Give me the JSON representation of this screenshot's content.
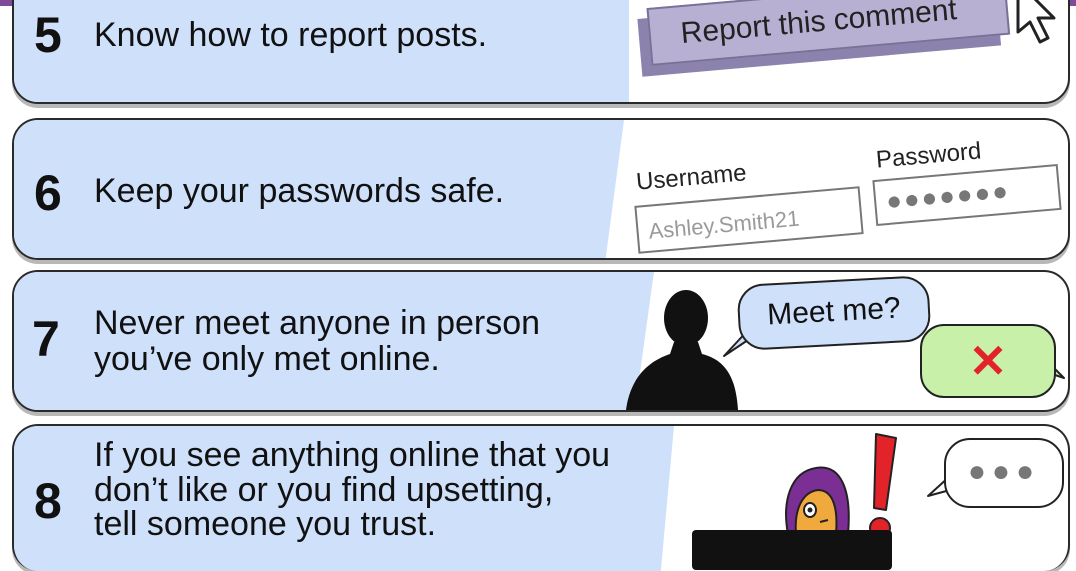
{
  "tips": [
    {
      "number": "5",
      "lines": [
        "Know how to report posts."
      ]
    },
    {
      "number": "6",
      "lines": [
        "Keep your passwords safe."
      ]
    },
    {
      "number": "7",
      "lines": [
        "Never meet anyone in person",
        "you’ve only met online."
      ]
    },
    {
      "number": "8",
      "lines": [
        "If you see anything online that you",
        "don’t like or you find upsetting,",
        "tell someone you trust."
      ]
    }
  ],
  "report_button": {
    "label": "Report this comment"
  },
  "login": {
    "username_label": "Username",
    "username_value": "Ashley.Smith21",
    "password_label": "Password",
    "password_mask": "●●●●●●●"
  },
  "chat": {
    "meet_text": "Meet me?",
    "reject_symbol": "✕",
    "typing_dots": "●●●"
  },
  "colors": {
    "card_blue": "#cfe0fb",
    "report_purple": "#b7b0d2",
    "reject_green": "#c8f0a8",
    "alert_red": "#e3232a",
    "top_bar": "#7e4a99"
  },
  "icons": [
    "mouse-cursor-icon",
    "person-silhouette-icon",
    "exclamation-icon",
    "worried-girl-icon"
  ]
}
